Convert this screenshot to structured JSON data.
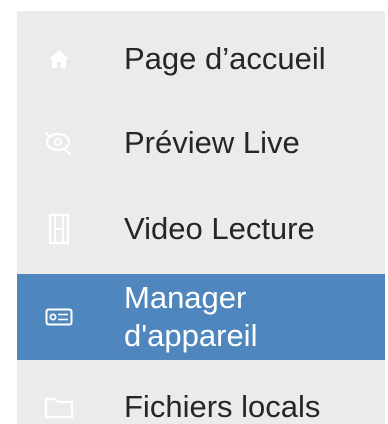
{
  "menu": {
    "items": [
      {
        "label": "Page d’accueil",
        "icon": "home-icon",
        "active": false
      },
      {
        "label": "Préview Live",
        "icon": "camera-icon",
        "active": false
      },
      {
        "label": "Video Lecture",
        "icon": "film-icon",
        "active": false
      },
      {
        "label": "Manager\nd'appareil",
        "icon": "device-icon",
        "active": true
      },
      {
        "label": "Fichiers locals",
        "icon": "folder-icon",
        "active": false
      }
    ]
  },
  "colors": {
    "menu_background": "#ebebeb",
    "active_background": "#4f86bd",
    "active_text": "#ffffff",
    "text": "#262626",
    "icon": "#ffffff"
  }
}
